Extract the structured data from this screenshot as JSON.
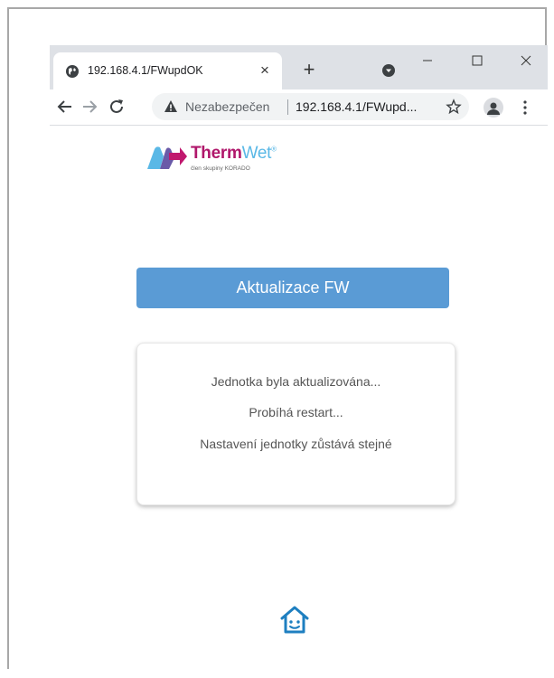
{
  "browser": {
    "tab_title": "192.168.4.1/FWupdOK",
    "tab_close": "×",
    "new_tab": "+",
    "security_label": "Nezabezpečen",
    "url": "192.168.4.1/FWupd...",
    "window_controls": {
      "minimize": "–",
      "maximize": "☐",
      "close": "✕"
    }
  },
  "logo": {
    "brand_main": "Therm",
    "brand_accent": "Wet",
    "brand_mark": "®",
    "subtitle": "člen skupiny KORADO"
  },
  "main": {
    "button_label": "Aktualizace FW",
    "status_lines": [
      "Jednotka byla aktualizována...",
      "Probíhá restart...",
      "Nastavení jednotky zůstává stejné"
    ]
  },
  "colors": {
    "accent_button": "#5a9bd5",
    "brand_magenta": "#b0176b",
    "brand_blue": "#5ab8e6",
    "home_icon": "#1e7fc0"
  },
  "icons": {
    "favicon": "globe-icon",
    "security": "warning-triangle-icon",
    "bookmark": "star-icon",
    "profile": "account-icon",
    "menu": "kebab-menu-icon",
    "home": "home-icon"
  }
}
